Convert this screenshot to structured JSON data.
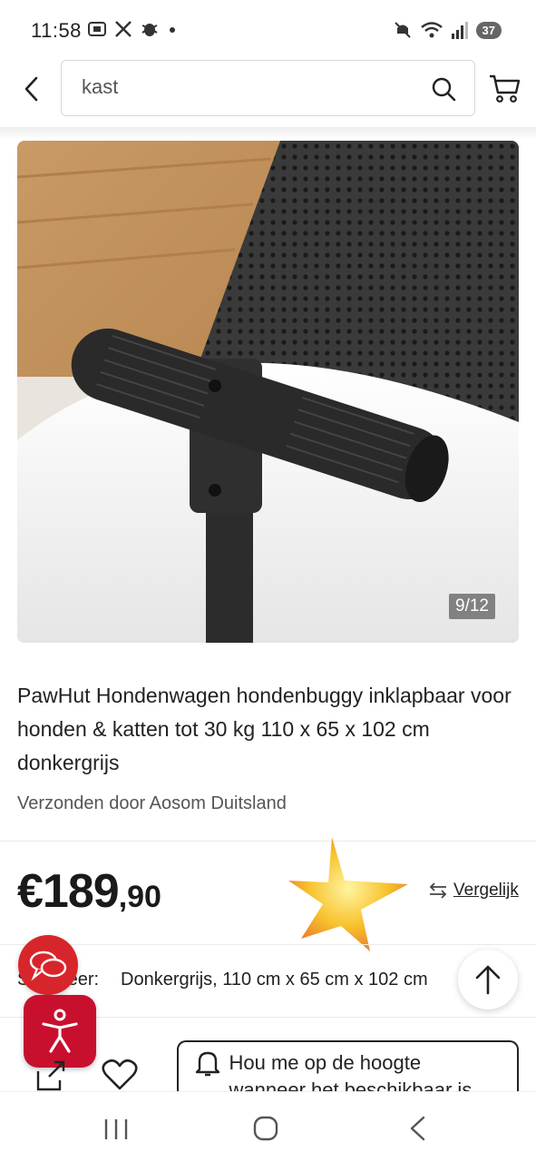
{
  "status_bar": {
    "time": "11:58",
    "battery": "37",
    "left_icons": [
      "screenshot-icon",
      "x-icon",
      "bug-icon",
      "dot-icon"
    ],
    "right_icons": [
      "mute-icon",
      "wifi-icon",
      "signal-icon",
      "battery-icon"
    ]
  },
  "header": {
    "search_value": "kast"
  },
  "product": {
    "image_counter": "9/12",
    "title": "PawHut Hondenwagen hondenbuggy inklapbaar voor honden & katten tot 30 kg 110 x 65 x 102 cm donkergrijs",
    "seller": "Verzonden door Aosom Duitsland",
    "price_main": "€189",
    "price_cents": ",90",
    "compare_label": "Vergelijk",
    "variant_label": "Selecteer:",
    "variant_value": "Donkergrijs, 110 cm x 65 cm x 102 cm"
  },
  "actions": {
    "notify_label": "Hou me op de hoogte wanneer het beschikbaar is"
  },
  "colors": {
    "accent_red": "#c8102e",
    "chat_red": "#d7262b",
    "text": "#222222"
  }
}
